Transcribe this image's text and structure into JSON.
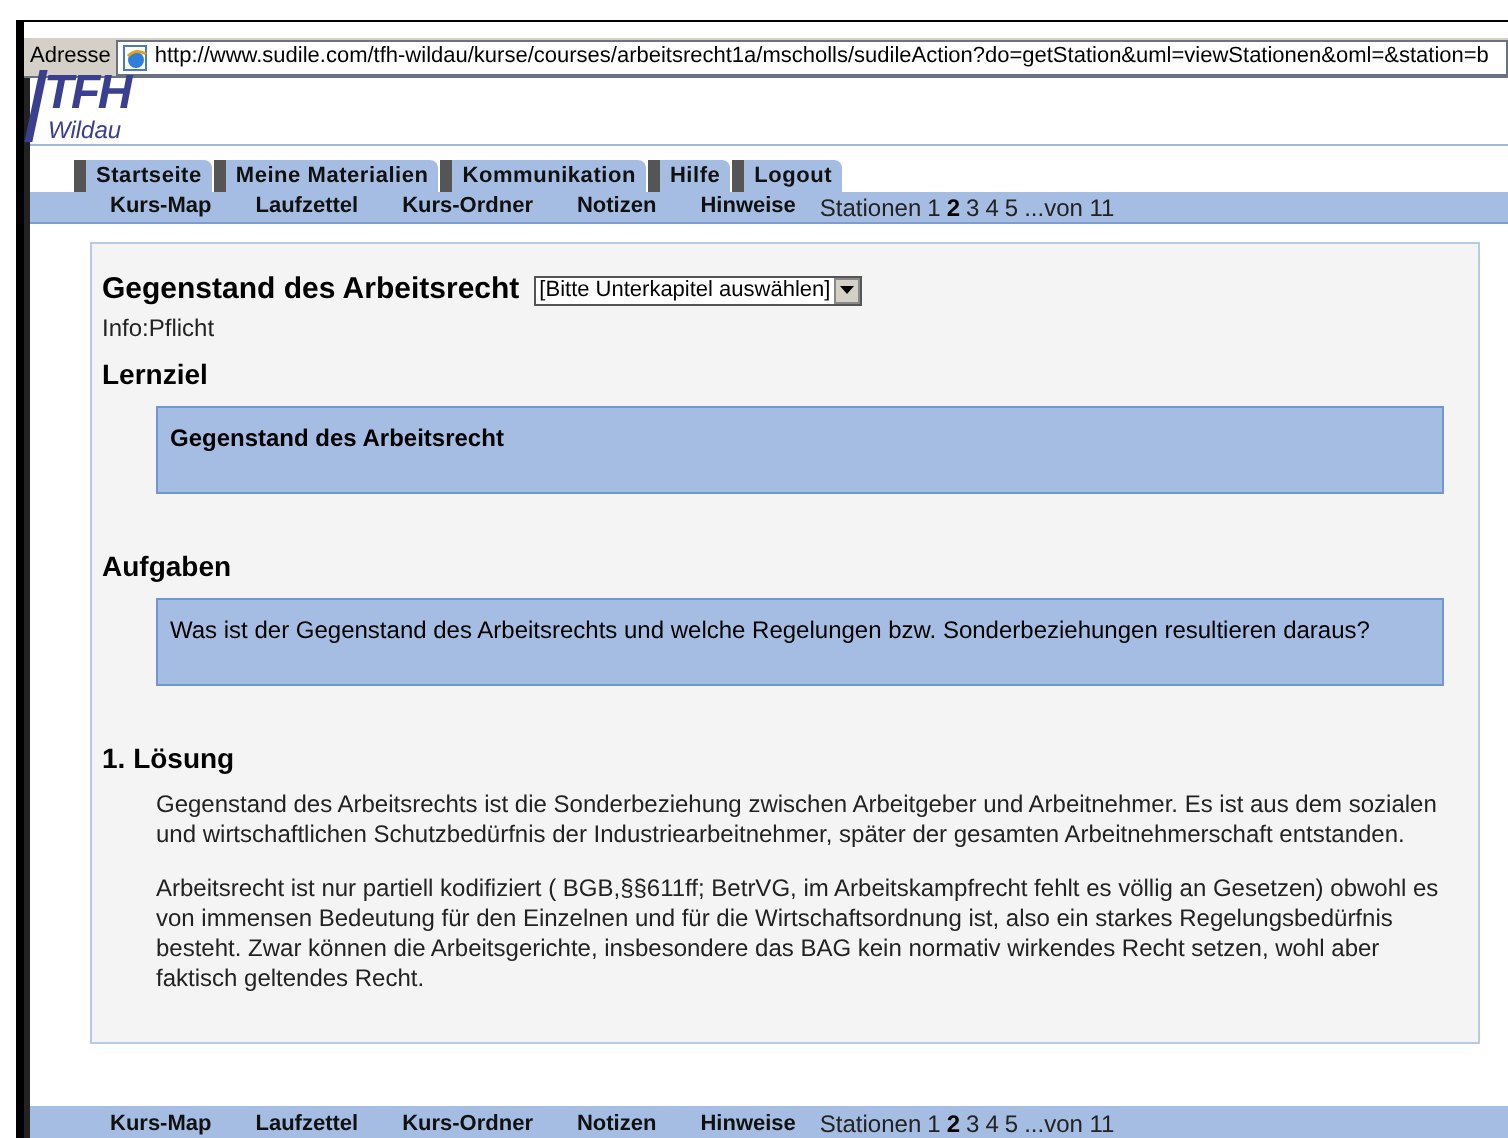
{
  "address_bar": {
    "label": "Adresse",
    "url": "http://www.sudile.com/tfh-wildau/kurse/courses/arbeitsrecht1a/mscholls/sudileAction?do=getStation&uml=viewStationen&oml=&station=b"
  },
  "logo": {
    "line_1": "TFH",
    "line_2": "Wildau"
  },
  "tabs": [
    {
      "label": "Startseite"
    },
    {
      "label": "Meine Materialien"
    },
    {
      "label": "Kommunikation"
    },
    {
      "label": "Hilfe"
    },
    {
      "label": "Logout"
    }
  ],
  "nav_top": {
    "links": [
      "Kurs-Map",
      "Laufzettel",
      "Kurs-Ordner",
      "Notizen",
      "Hinweise"
    ],
    "stations_label": "Stationen",
    "stations": [
      {
        "label": "1",
        "selected": false
      },
      {
        "label": "2",
        "selected": true
      },
      {
        "label": "3",
        "selected": false
      },
      {
        "label": "4",
        "selected": false
      },
      {
        "label": "5",
        "selected": false
      }
    ],
    "stations_total": "...von 11"
  },
  "station": {
    "title": "Gegenstand des Arbeitsrecht",
    "chapter_select": "[Bitte Unterkapitel auswählen]",
    "info": "Info:Pflicht",
    "sections": [
      {
        "heading": "Lernziel",
        "kind": "box",
        "box_text": "Gegenstand des Arbeitsrecht",
        "bold": true
      },
      {
        "heading": "Aufgaben",
        "kind": "box",
        "box_text": "Was ist der Gegenstand des Arbeitsrechts und welche Regelungen bzw. Sonderbeziehungen resultieren daraus?",
        "bold": false
      },
      {
        "heading": "1. Lösung",
        "kind": "text",
        "paragraphs": [
          "Gegenstand des Arbeitsrechts ist die Sonderbeziehung zwischen Arbeitgeber und Arbeitnehmer. Es ist aus dem sozialen und wirtschaftlichen Schutzbedürfnis der Industriearbeitnehmer, später der gesamten Arbeitnehmerschaft entstanden.",
          "Arbeitsrecht ist nur partiell kodifiziert ( BGB,§§611ff; BetrVG, im Arbeitskampfrecht fehlt es völlig an Gesetzen) obwohl es von immensen Bedeutung für den Einzelnen und für die Wirtschaftsordnung ist, also ein starkes Regelungsbedürfnis besteht. Zwar können die Arbeitsgerichte, insbesondere das BAG kein normativ wirkendes Recht setzen, wohl aber faktisch geltendes Recht."
        ]
      }
    ]
  },
  "nav_bottom": {
    "links": [
      "Kurs-Map",
      "Laufzettel",
      "Kurs-Ordner",
      "Notizen",
      "Hinweise"
    ],
    "stations_label": "Stationen",
    "stations": [
      {
        "label": "1",
        "selected": false
      },
      {
        "label": "2",
        "selected": true
      },
      {
        "label": "3",
        "selected": false
      },
      {
        "label": "4",
        "selected": false
      },
      {
        "label": "5",
        "selected": false
      }
    ],
    "stations_total": "...von 11"
  }
}
